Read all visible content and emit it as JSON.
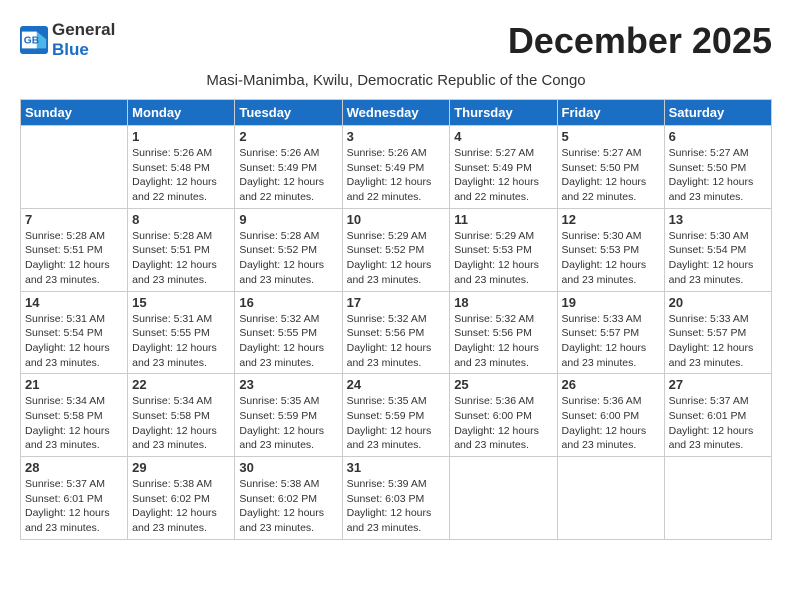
{
  "logo": {
    "text_general": "General",
    "text_blue": "Blue"
  },
  "header": {
    "month": "December 2025",
    "location": "Masi-Manimba, Kwilu, Democratic Republic of the Congo"
  },
  "days_of_week": [
    "Sunday",
    "Monday",
    "Tuesday",
    "Wednesday",
    "Thursday",
    "Friday",
    "Saturday"
  ],
  "weeks": [
    [
      {
        "day": "",
        "sunrise": "",
        "sunset": "",
        "daylight": ""
      },
      {
        "day": "1",
        "sunrise": "Sunrise: 5:26 AM",
        "sunset": "Sunset: 5:48 PM",
        "daylight": "Daylight: 12 hours and 22 minutes."
      },
      {
        "day": "2",
        "sunrise": "Sunrise: 5:26 AM",
        "sunset": "Sunset: 5:49 PM",
        "daylight": "Daylight: 12 hours and 22 minutes."
      },
      {
        "day": "3",
        "sunrise": "Sunrise: 5:26 AM",
        "sunset": "Sunset: 5:49 PM",
        "daylight": "Daylight: 12 hours and 22 minutes."
      },
      {
        "day": "4",
        "sunrise": "Sunrise: 5:27 AM",
        "sunset": "Sunset: 5:49 PM",
        "daylight": "Daylight: 12 hours and 22 minutes."
      },
      {
        "day": "5",
        "sunrise": "Sunrise: 5:27 AM",
        "sunset": "Sunset: 5:50 PM",
        "daylight": "Daylight: 12 hours and 22 minutes."
      },
      {
        "day": "6",
        "sunrise": "Sunrise: 5:27 AM",
        "sunset": "Sunset: 5:50 PM",
        "daylight": "Daylight: 12 hours and 23 minutes."
      }
    ],
    [
      {
        "day": "7",
        "sunrise": "Sunrise: 5:28 AM",
        "sunset": "Sunset: 5:51 PM",
        "daylight": "Daylight: 12 hours and 23 minutes."
      },
      {
        "day": "8",
        "sunrise": "Sunrise: 5:28 AM",
        "sunset": "Sunset: 5:51 PM",
        "daylight": "Daylight: 12 hours and 23 minutes."
      },
      {
        "day": "9",
        "sunrise": "Sunrise: 5:28 AM",
        "sunset": "Sunset: 5:52 PM",
        "daylight": "Daylight: 12 hours and 23 minutes."
      },
      {
        "day": "10",
        "sunrise": "Sunrise: 5:29 AM",
        "sunset": "Sunset: 5:52 PM",
        "daylight": "Daylight: 12 hours and 23 minutes."
      },
      {
        "day": "11",
        "sunrise": "Sunrise: 5:29 AM",
        "sunset": "Sunset: 5:53 PM",
        "daylight": "Daylight: 12 hours and 23 minutes."
      },
      {
        "day": "12",
        "sunrise": "Sunrise: 5:30 AM",
        "sunset": "Sunset: 5:53 PM",
        "daylight": "Daylight: 12 hours and 23 minutes."
      },
      {
        "day": "13",
        "sunrise": "Sunrise: 5:30 AM",
        "sunset": "Sunset: 5:54 PM",
        "daylight": "Daylight: 12 hours and 23 minutes."
      }
    ],
    [
      {
        "day": "14",
        "sunrise": "Sunrise: 5:31 AM",
        "sunset": "Sunset: 5:54 PM",
        "daylight": "Daylight: 12 hours and 23 minutes."
      },
      {
        "day": "15",
        "sunrise": "Sunrise: 5:31 AM",
        "sunset": "Sunset: 5:55 PM",
        "daylight": "Daylight: 12 hours and 23 minutes."
      },
      {
        "day": "16",
        "sunrise": "Sunrise: 5:32 AM",
        "sunset": "Sunset: 5:55 PM",
        "daylight": "Daylight: 12 hours and 23 minutes."
      },
      {
        "day": "17",
        "sunrise": "Sunrise: 5:32 AM",
        "sunset": "Sunset: 5:56 PM",
        "daylight": "Daylight: 12 hours and 23 minutes."
      },
      {
        "day": "18",
        "sunrise": "Sunrise: 5:32 AM",
        "sunset": "Sunset: 5:56 PM",
        "daylight": "Daylight: 12 hours and 23 minutes."
      },
      {
        "day": "19",
        "sunrise": "Sunrise: 5:33 AM",
        "sunset": "Sunset: 5:57 PM",
        "daylight": "Daylight: 12 hours and 23 minutes."
      },
      {
        "day": "20",
        "sunrise": "Sunrise: 5:33 AM",
        "sunset": "Sunset: 5:57 PM",
        "daylight": "Daylight: 12 hours and 23 minutes."
      }
    ],
    [
      {
        "day": "21",
        "sunrise": "Sunrise: 5:34 AM",
        "sunset": "Sunset: 5:58 PM",
        "daylight": "Daylight: 12 hours and 23 minutes."
      },
      {
        "day": "22",
        "sunrise": "Sunrise: 5:34 AM",
        "sunset": "Sunset: 5:58 PM",
        "daylight": "Daylight: 12 hours and 23 minutes."
      },
      {
        "day": "23",
        "sunrise": "Sunrise: 5:35 AM",
        "sunset": "Sunset: 5:59 PM",
        "daylight": "Daylight: 12 hours and 23 minutes."
      },
      {
        "day": "24",
        "sunrise": "Sunrise: 5:35 AM",
        "sunset": "Sunset: 5:59 PM",
        "daylight": "Daylight: 12 hours and 23 minutes."
      },
      {
        "day": "25",
        "sunrise": "Sunrise: 5:36 AM",
        "sunset": "Sunset: 6:00 PM",
        "daylight": "Daylight: 12 hours and 23 minutes."
      },
      {
        "day": "26",
        "sunrise": "Sunrise: 5:36 AM",
        "sunset": "Sunset: 6:00 PM",
        "daylight": "Daylight: 12 hours and 23 minutes."
      },
      {
        "day": "27",
        "sunrise": "Sunrise: 5:37 AM",
        "sunset": "Sunset: 6:01 PM",
        "daylight": "Daylight: 12 hours and 23 minutes."
      }
    ],
    [
      {
        "day": "28",
        "sunrise": "Sunrise: 5:37 AM",
        "sunset": "Sunset: 6:01 PM",
        "daylight": "Daylight: 12 hours and 23 minutes."
      },
      {
        "day": "29",
        "sunrise": "Sunrise: 5:38 AM",
        "sunset": "Sunset: 6:02 PM",
        "daylight": "Daylight: 12 hours and 23 minutes."
      },
      {
        "day": "30",
        "sunrise": "Sunrise: 5:38 AM",
        "sunset": "Sunset: 6:02 PM",
        "daylight": "Daylight: 12 hours and 23 minutes."
      },
      {
        "day": "31",
        "sunrise": "Sunrise: 5:39 AM",
        "sunset": "Sunset: 6:03 PM",
        "daylight": "Daylight: 12 hours and 23 minutes."
      },
      {
        "day": "",
        "sunrise": "",
        "sunset": "",
        "daylight": ""
      },
      {
        "day": "",
        "sunrise": "",
        "sunset": "",
        "daylight": ""
      },
      {
        "day": "",
        "sunrise": "",
        "sunset": "",
        "daylight": ""
      }
    ]
  ]
}
